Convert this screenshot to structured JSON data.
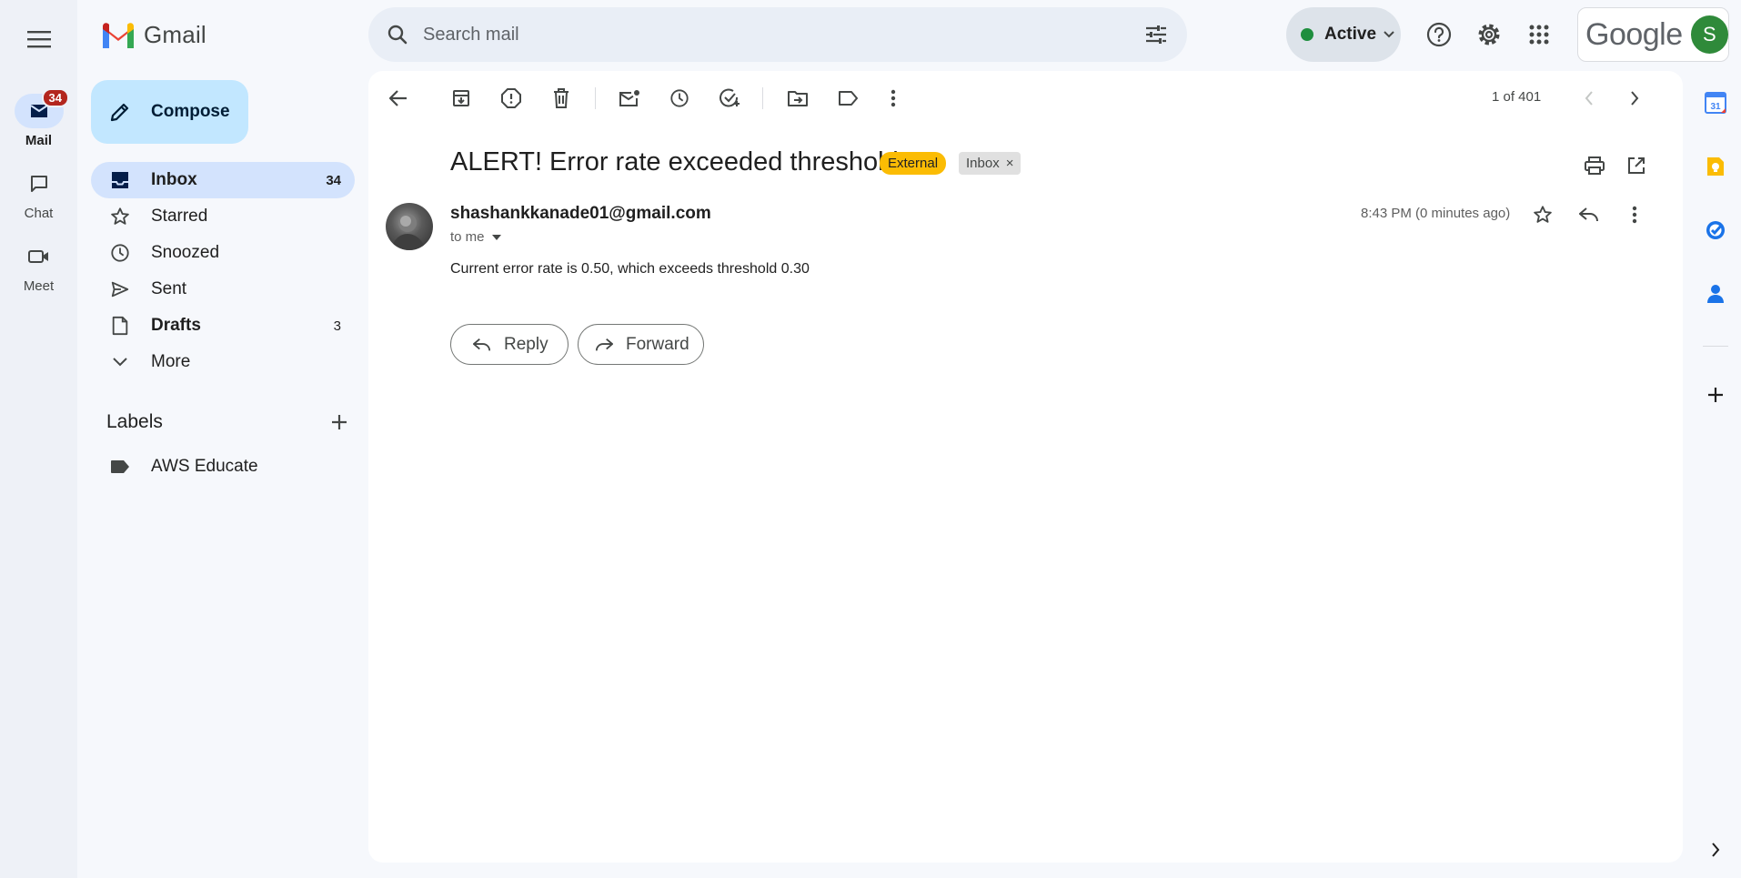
{
  "app": {
    "name": "Gmail"
  },
  "rail": {
    "items": [
      {
        "label": "Mail",
        "badge": "34",
        "active": true
      },
      {
        "label": "Chat"
      },
      {
        "label": "Meet"
      }
    ]
  },
  "search": {
    "placeholder": "Search mail"
  },
  "status": {
    "label": "Active"
  },
  "account": {
    "brand_word": "Google",
    "avatar_letter": "S"
  },
  "compose": {
    "label": "Compose"
  },
  "nav": {
    "items": [
      {
        "label": "Inbox",
        "count": "34"
      },
      {
        "label": "Starred",
        "count": ""
      },
      {
        "label": "Snoozed",
        "count": ""
      },
      {
        "label": "Sent",
        "count": ""
      },
      {
        "label": "Drafts",
        "count": "3"
      },
      {
        "label": "More",
        "count": ""
      }
    ]
  },
  "labels": {
    "heading": "Labels",
    "items": [
      {
        "label": "AWS Educate"
      }
    ]
  },
  "toolbar": {
    "pager": "1 of 401"
  },
  "message": {
    "subject": "ALERT! Error rate exceeded threshold",
    "tags": {
      "external": "External",
      "inbox": "Inbox",
      "remove": "×"
    },
    "sender": "shashankkanade01@gmail.com",
    "to": "to me",
    "time": "8:43 PM (0 minutes ago)",
    "body": "Current error rate is 0.50, which exceeds threshold 0.30"
  },
  "actions": {
    "reply": "Reply",
    "forward": "Forward"
  },
  "side_panel": {
    "calendar_day": "31"
  },
  "colors": {
    "accent_blue": "#0b57d0",
    "active_nav": "#d3e3fd",
    "compose_bg": "#c2e7ff",
    "badge_red": "#b3261e",
    "external_tag": "#fbbc04",
    "status_green": "#1e8e3e"
  }
}
